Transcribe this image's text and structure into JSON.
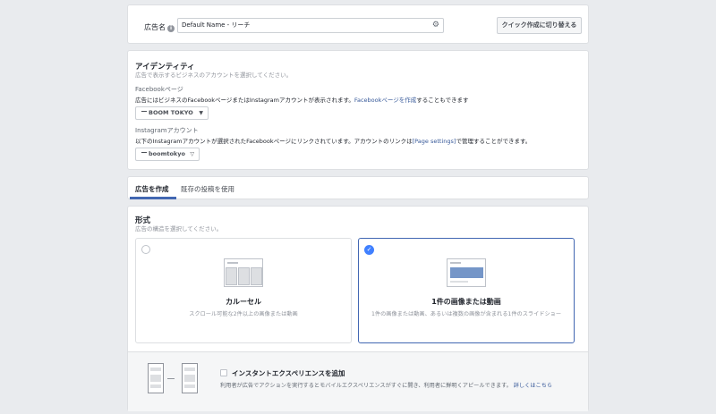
{
  "ad_name": {
    "label": "広告名",
    "info_icon": "info-icon",
    "value": "Default Name - リーチ",
    "settings_icon": "gear-icon",
    "quick_switch_button": "クイック作成に切り替える"
  },
  "identity": {
    "title": "アイデンティティ",
    "subtitle": "広告で表示するビジネスのアカウントを選択してください。",
    "facebook_page": {
      "label": "Facebookページ",
      "description": "広告にはビジネスのFacebookページまたはInstagramアカウントが表示されます。",
      "link_text": "Facebookページを作成",
      "description_suffix": "することもできます",
      "selected": "BOOM TOKYO"
    },
    "instagram_account": {
      "label": "Instagramアカウント",
      "description": "以下のInstagramアカウントが選択されたFacebookページにリンクされています。アカウントのリンクは",
      "link_text": "[Page settings]",
      "description_suffix": "で管理することができます。",
      "selected": "boomtokyo"
    }
  },
  "tabs": [
    {
      "label": "広告を作成",
      "active": true
    },
    {
      "label": "既存の投稿を使用",
      "active": false
    }
  ],
  "format": {
    "title": "形式",
    "subtitle": "広告の構造を選択してください。",
    "options": [
      {
        "title": "カルーセル",
        "description": "スクロール可能な2件以上の画像または動画",
        "selected": false
      },
      {
        "title": "1件の画像または動画",
        "description": "1件の画像または動画、あるいは複数の画像が含まれる1件のスライドショー",
        "selected": true
      }
    ],
    "instant_experience": {
      "title": "インスタントエクスペリエンスを追加",
      "description": "利用者が広告でアクションを実行するとモバイルエクスペリエンスがすぐに開き、利用者に鮮明くアピールできます。",
      "link_text": "詳しくはこちら",
      "checked": false
    }
  },
  "colors": {
    "accent": "#4267b2",
    "check": "#4080ff",
    "link": "#365899",
    "background": "#e9ebee"
  }
}
